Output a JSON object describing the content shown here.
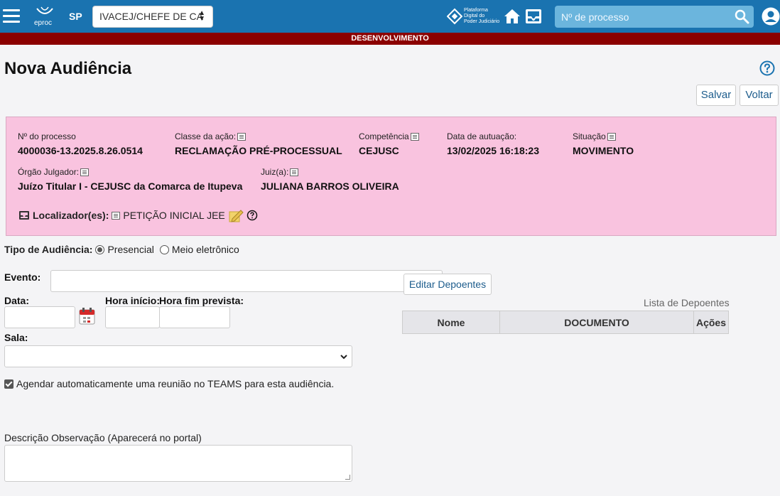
{
  "header": {
    "logo_text": "eproc",
    "state": "SP",
    "unit_select": "IVACEJ/CHEFE DE CA",
    "pdpj_text": [
      "Plataforma",
      "Digital do",
      "Poder Judiciário"
    ],
    "search_placeholder": "Nº de processo",
    "icons": [
      "menu-icon",
      "home-icon",
      "inbox-icon",
      "search-icon",
      "user-icon"
    ],
    "color": "#1a73b0"
  },
  "env_banner": {
    "text": "DESENVOLVIMENTO",
    "color": "#8b0000"
  },
  "page": {
    "title": "Nova Audiência",
    "save_label": "Salvar",
    "back_label": "Voltar"
  },
  "process": {
    "numero_label": "Nº do processo",
    "numero": "4000036-13.2025.8.26.0514",
    "classe_label": "Classe da ação:",
    "classe": "RECLAMAÇÃO PRÉ-PROCESSUAL",
    "competencia_label": "Competência",
    "competencia": "CEJUSC",
    "data_label": "Data de autuação:",
    "data": "13/02/2025 16:18:23",
    "situacao_label": "Situação",
    "situacao": "MOVIMENTO",
    "orgao_label": "Órgão Julgador:",
    "orgao": "Juízo Titular I - CEJUSC da Comarca de Itupeva",
    "juiz_label": "Juiz(a):",
    "juiz": "JULIANA BARROS OLIVEIRA",
    "localizador_label": "Localizador(es):",
    "localizador": "PETIÇÃO INICIAL JEE",
    "box_color": "#f9c3df"
  },
  "form": {
    "tipo_label": "Tipo de Audiência:",
    "tipo_options": [
      "Presencial",
      "Meio eletrônico"
    ],
    "tipo_selected": "Presencial",
    "evento_label": "Evento:",
    "evento_value": "",
    "data_label": "Data:",
    "data_value": "",
    "hora_inicio_label": "Hora início:",
    "hora_inicio_value": "",
    "hora_fim_label": "Hora fim prevista:",
    "hora_fim_value": "",
    "sala_label": "Sala:",
    "sala_value": "",
    "teams_label": "Agendar automaticamente uma reunião no TEAMS para esta audiência.",
    "teams_checked": true,
    "descricao_label": "Descrição Observação (Aparecerá no portal)",
    "descricao_value": ""
  },
  "depoentes": {
    "edit_button": "Editar Depoentes",
    "caption": "Lista de Depoentes",
    "columns": [
      "Nome",
      "DOCUMENTO",
      "Ações"
    ]
  }
}
